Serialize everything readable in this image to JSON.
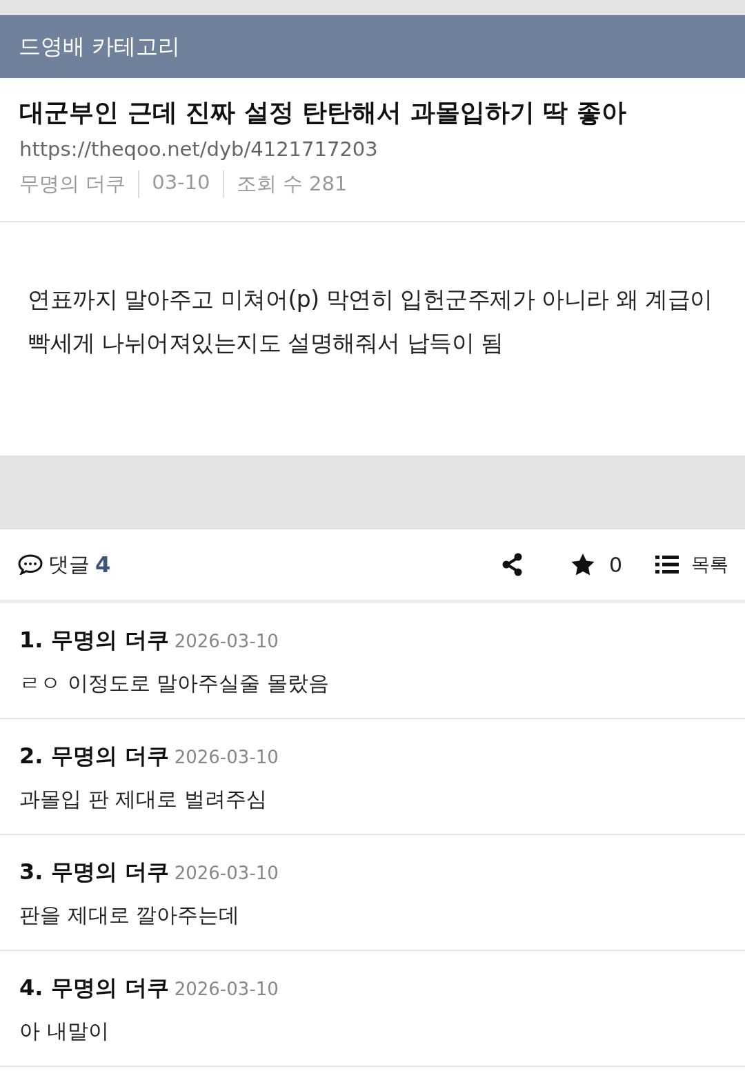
{
  "category": "드영배 카테고리",
  "post": {
    "title": "대군부인 근데 진짜 설정 탄탄해서 과몰입하기 딱 좋아",
    "url": "https://theqoo.net/dyb/4121717203",
    "meta": [
      "무명의 더쿠",
      "03-10",
      "조회 수 281"
    ],
    "body": "연표까지 말아주고 미쳐어(p) 막연히 입헌군주제가 아니라 왜 계급이 빡세게 나뉘어져있는지도 설명해줘서 납득이 됨"
  },
  "actions": {
    "comments_label": "댓글",
    "comments_count": "4",
    "star_count": "0",
    "list_label": "목록"
  },
  "comments": [
    {
      "number": "1.",
      "author": "무명의 더쿠",
      "date": "2026-03-10",
      "text": "ㄹㅇ 이정도로 말아주실줄 몰랐음"
    },
    {
      "number": "2.",
      "author": "무명의 더쿠",
      "date": "2026-03-10",
      "text": "과몰입 판 제대로 벌려주심"
    },
    {
      "number": "3.",
      "author": "무명의 더쿠",
      "date": "2026-03-10",
      "text": "판을 제대로 깔아주는데"
    },
    {
      "number": "4.",
      "author": "무명의 더쿠",
      "date": "2026-03-10",
      "text": "아 내말이"
    }
  ]
}
